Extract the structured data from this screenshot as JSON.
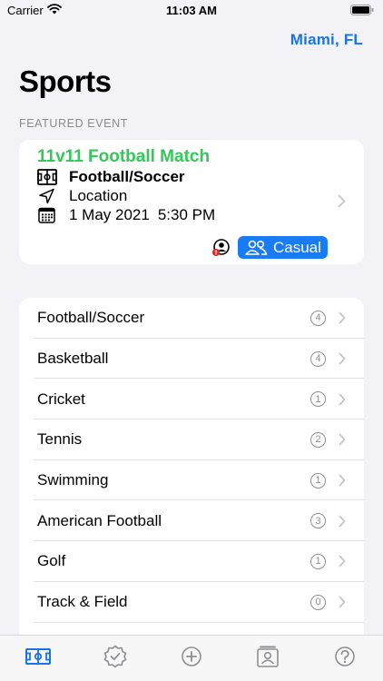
{
  "status": {
    "carrier": "Carrier",
    "time": "11:03 AM"
  },
  "header": {
    "location": "Miami, FL",
    "title": "Sports"
  },
  "featured": {
    "caption": "FEATURED EVENT",
    "title": "11v11 Football Match",
    "sport": "Football/Soccer",
    "location": "Location",
    "date": "1 May 2021",
    "time": "5:30 PM",
    "badge": "Casual"
  },
  "sports": [
    {
      "name": "Football/Soccer",
      "count": "4"
    },
    {
      "name": "Basketball",
      "count": "4"
    },
    {
      "name": "Cricket",
      "count": "1"
    },
    {
      "name": "Tennis",
      "count": "2"
    },
    {
      "name": "Swimming",
      "count": "1"
    },
    {
      "name": "American Football",
      "count": "3"
    },
    {
      "name": "Golf",
      "count": "1"
    },
    {
      "name": "Track & Field",
      "count": "0"
    },
    {
      "name": "",
      "count": ""
    }
  ],
  "colors": {
    "accent": "#1a73e8",
    "event_title": "#34c759",
    "badge": "#1a7cf5",
    "tab_active": "#1a73e8",
    "tab_inactive": "#8e8e93"
  },
  "tabs": [
    {
      "icon": "field-icon",
      "active": true
    },
    {
      "icon": "verified-badge-icon",
      "active": false
    },
    {
      "icon": "add-circle-icon",
      "active": false
    },
    {
      "icon": "contact-card-icon",
      "active": false
    },
    {
      "icon": "help-circle-icon",
      "active": false
    }
  ]
}
